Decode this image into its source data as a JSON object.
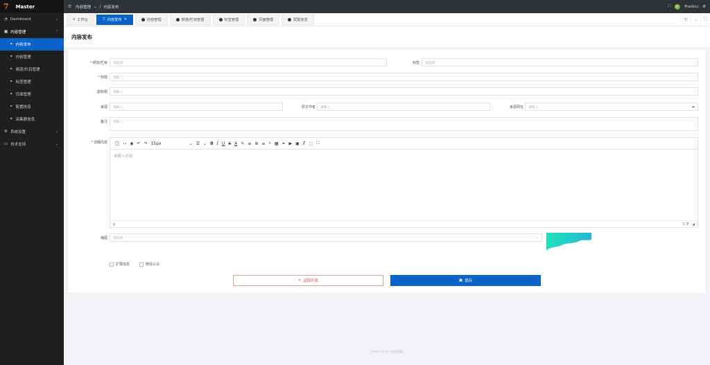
{
  "app": {
    "brand_glyph": "7",
    "brand": "Master"
  },
  "sidebar": {
    "items": [
      {
        "label": "Dashboard",
        "icon": "dashboard-icon"
      },
      {
        "label": "内容管理",
        "icon": "grid-icon"
      },
      {
        "label": "内容发布",
        "icon": "link-icon"
      },
      {
        "label": "内容管理",
        "icon": "link-icon"
      },
      {
        "label": "频道/栏目管理",
        "icon": "link-icon"
      },
      {
        "label": "标签管理",
        "icon": "link-icon"
      },
      {
        "label": "页面管理",
        "icon": "link-icon"
      },
      {
        "label": "配置信息",
        "icon": "link-icon"
      },
      {
        "label": "采集器信息",
        "icon": "link-icon"
      },
      {
        "label": "系统设置",
        "icon": "gear-icon"
      },
      {
        "label": "技术支持",
        "icon": "monitor-icon"
      }
    ]
  },
  "topbar": {
    "crumb1": "内容管理",
    "crumb_sep": "/",
    "crumb2": "内容发布",
    "user": "FrankLi"
  },
  "tabs": [
    {
      "label": "工作台"
    },
    {
      "label": "内容发布",
      "close": "×"
    },
    {
      "label": "内容管理"
    },
    {
      "label": "频道/栏目管理"
    },
    {
      "label": "标签管理"
    },
    {
      "label": "页面管理"
    },
    {
      "label": "配置信息"
    }
  ],
  "page": {
    "title": "内容发布"
  },
  "form": {
    "channel_label": "频道/栏目",
    "channel_placeholder": "请选择",
    "tag_label": "标签",
    "tag_placeholder": "请选择",
    "title_label": "标题",
    "title_placeholder": "请输入",
    "subtitle_label": "副标题",
    "subtitle_placeholder": "请输入",
    "source_label": "来源",
    "source_placeholder": "请输入",
    "author_label": "原文作者",
    "author_placeholder": "请输入",
    "source_url_label": "来源网址",
    "source_url_placeholder": "请输入",
    "remark_label": "备注",
    "remark_placeholder": "请输入",
    "content_label": "详细内容",
    "editor": {
      "font_size": "15px",
      "placeholder": "请输入内容",
      "path": "p",
      "count": "0 字"
    },
    "thumb_label": "缩图",
    "thumb_placeholder": "请选择",
    "ext_label": "扩展信息",
    "wechat_label": "微信公众"
  },
  "buttons": {
    "back": "返回列表",
    "save": "保存"
  },
  "footer": "Powered by 主站设置",
  "colors": {
    "primary": "#0b63c9",
    "sidebar": "#1f1f1f",
    "danger": "#e0584a"
  }
}
